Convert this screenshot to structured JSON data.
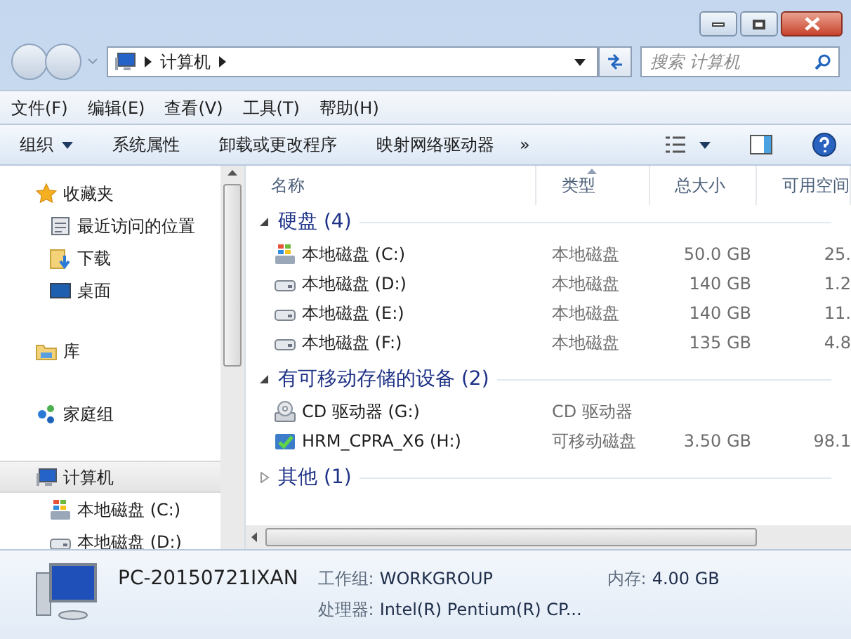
{
  "address": {
    "path": [
      "计算机"
    ]
  },
  "search": {
    "placeholder": "搜索 计算机"
  },
  "menu": [
    "文件(F)",
    "编辑(E)",
    "查看(V)",
    "工具(T)",
    "帮助(H)"
  ],
  "toolbar": {
    "items": [
      {
        "label": "组织",
        "has_menu": true
      },
      {
        "label": "系统属性",
        "has_menu": false
      },
      {
        "label": "卸载或更改程序",
        "has_menu": false
      },
      {
        "label": "映射网络驱动器",
        "has_menu": false
      }
    ],
    "overflow": "»"
  },
  "nav": [
    {
      "label": "收藏夹",
      "kind": "star",
      "selected": false,
      "children": [
        {
          "label": "最近访问的位置",
          "kind": "recent",
          "selected": false
        },
        {
          "label": "下载",
          "kind": "download",
          "selected": false
        },
        {
          "label": "桌面",
          "kind": "desktop",
          "selected": false
        }
      ]
    },
    {
      "label": "库",
      "kind": "library",
      "selected": false
    },
    {
      "label": "家庭组",
      "kind": "homegroup",
      "selected": false
    },
    {
      "label": "计算机",
      "kind": "computer",
      "selected": true,
      "children": [
        {
          "label": "本地磁盘 (C:)",
          "kind": "system",
          "selected": false
        },
        {
          "label": "本地磁盘 (D:)",
          "kind": "disk",
          "selected": false
        }
      ]
    }
  ],
  "columns": [
    {
      "label": "名称",
      "sorted": false
    },
    {
      "label": "类型",
      "sorted": true
    },
    {
      "label": "总大小",
      "sorted": false
    },
    {
      "label": "可用空间",
      "sorted": false
    }
  ],
  "groups": [
    {
      "title": "硬盘 (4)",
      "expanded": true,
      "items": [
        {
          "name": "本地磁盘 (C:)",
          "kind": "system",
          "type": "本地磁盘",
          "total": "50.0 GB",
          "free": "25."
        },
        {
          "name": "本地磁盘 (D:)",
          "kind": "disk",
          "type": "本地磁盘",
          "total": "140 GB",
          "free": "1.2"
        },
        {
          "name": "本地磁盘 (E:)",
          "kind": "disk",
          "type": "本地磁盘",
          "total": "140 GB",
          "free": "11."
        },
        {
          "name": "本地磁盘 (F:)",
          "kind": "disk",
          "type": "本地磁盘",
          "total": "135 GB",
          "free": "4.8"
        }
      ]
    },
    {
      "title": "有可移动存储的设备 (2)",
      "expanded": true,
      "items": [
        {
          "name": "CD 驱动器 (G:)",
          "kind": "cd",
          "type": "CD 驱动器"
        },
        {
          "name": "HRM_CPRA_X6 (H:)",
          "kind": "removable",
          "type": "可移动磁盘",
          "total": "3.50 GB",
          "free": "98.1"
        }
      ]
    },
    {
      "title": "其他 (1)",
      "expanded": false
    }
  ],
  "details": {
    "name": "PC-20150721IXAN",
    "fields": [
      {
        "label": "工作组:",
        "value": "WORKGROUP"
      },
      {
        "label": "内存:",
        "value": "4.00 GB"
      },
      {
        "label": "处理器:",
        "value": "Intel(R) Pentium(R) CP..."
      }
    ]
  }
}
